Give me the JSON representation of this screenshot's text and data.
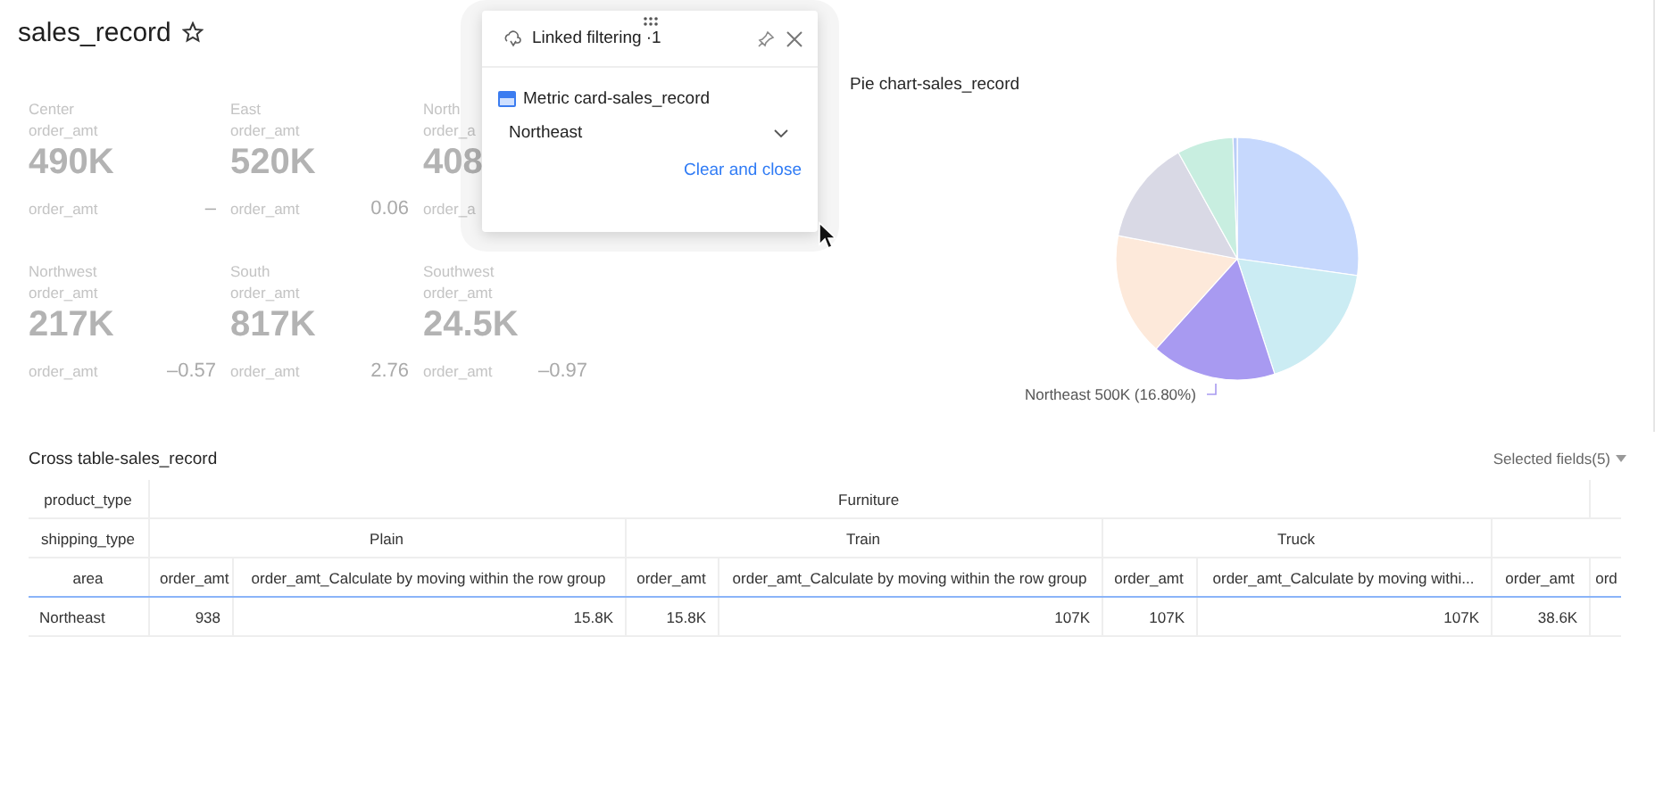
{
  "title": "sales_record",
  "metric_cards": [
    {
      "region": "Center",
      "metric": "order_amt",
      "value": "490K",
      "footer_label": "order_amt",
      "footer_value": "–"
    },
    {
      "region": "East",
      "metric": "order_amt",
      "value": "520K",
      "footer_label": "order_amt",
      "footer_value": "0.06"
    },
    {
      "region": "North",
      "metric": "order_a",
      "value": "408",
      "footer_label": "order_a"
    },
    {
      "region": "Northwest",
      "metric": "order_amt",
      "value": "217K",
      "footer_label": "order_amt",
      "footer_value": "–0.57"
    },
    {
      "region": "South",
      "metric": "order_amt",
      "value": "817K",
      "footer_label": "order_amt",
      "footer_value": "2.76"
    },
    {
      "region": "Southwest",
      "metric": "order_amt",
      "value": "24.5K",
      "footer_label": "order_amt",
      "footer_value": "–0.97"
    }
  ],
  "pie_chart": {
    "title": "Pie chart-sales_record",
    "label": "Northeast 500K (16.80%)"
  },
  "cross_table": {
    "title": "Cross table-sales_record",
    "fields_button": "Selected fields(5)",
    "header_rows": [
      {
        "label": "product_type",
        "cells": [
          "Furniture"
        ]
      },
      {
        "label": "shipping_type",
        "cells": [
          "Plain",
          "Train",
          "Truck"
        ]
      },
      {
        "label": "area",
        "cells": [
          "order_amt",
          "order_amt_Calculate by moving within the row group",
          "order_amt",
          "order_amt_Calculate by moving within the row group",
          "order_amt",
          "order_amt_Calculate by moving withi...",
          "order_amt",
          "ord"
        ]
      }
    ],
    "rows": [
      {
        "area": "Northeast",
        "values": [
          "938",
          "15.8K",
          "15.8K",
          "107K",
          "107K",
          "107K",
          "38.6K"
        ]
      }
    ]
  },
  "popover": {
    "title": "Linked filtering ·1",
    "source": "Metric card-sales_record",
    "select_value": "Northeast",
    "link": "Clear and close"
  }
}
